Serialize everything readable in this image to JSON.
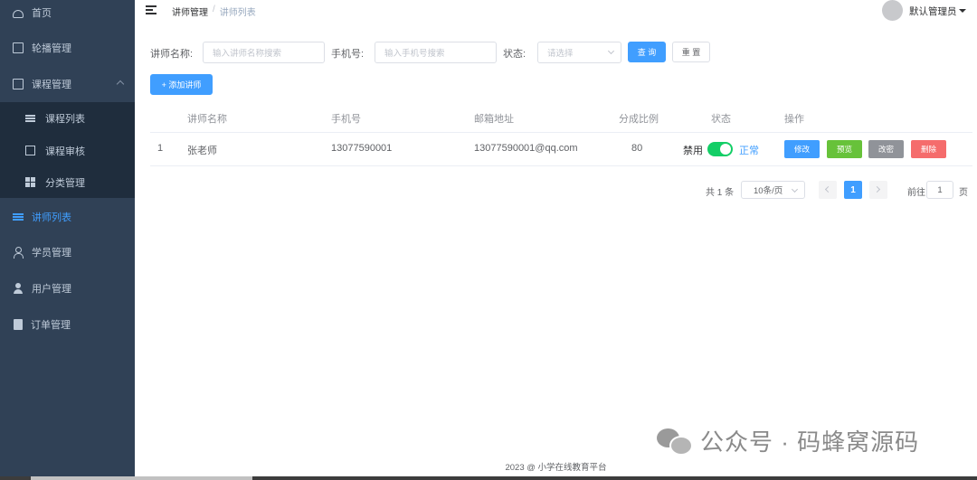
{
  "sidebar": {
    "items": [
      {
        "label": "首页",
        "icon": "dashboard-icon"
      },
      {
        "label": "轮播管理",
        "icon": "screen-icon"
      },
      {
        "label": "课程管理",
        "icon": "document-icon"
      },
      {
        "label": "讲师列表",
        "icon": "list-icon"
      },
      {
        "label": "学员管理",
        "icon": "person-outline-icon"
      },
      {
        "label": "用户管理",
        "icon": "person-icon"
      },
      {
        "label": "订单管理",
        "icon": "clipboard-icon"
      }
    ],
    "submenu": [
      {
        "label": "课程列表",
        "icon": "list-icon"
      },
      {
        "label": "课程审核",
        "icon": "checkbox-icon"
      },
      {
        "label": "分类管理",
        "icon": "grid-icon"
      }
    ],
    "background": "#304156",
    "submenu_background": "#1f2d3d",
    "active_color": "#409eff"
  },
  "header": {
    "breadcrumb": [
      "讲师管理",
      "/",
      "讲师列表"
    ],
    "user": "默认管理员"
  },
  "search": {
    "name_label": "讲师名称:",
    "name_placeholder": "输入讲师名称搜索",
    "phone_label": "手机号:",
    "phone_placeholder": "输入手机号搜索",
    "status_label": "状态:",
    "status_placeholder": "请选择",
    "query_button": "查 询",
    "reset_button": "重 置",
    "add_button": "+ 添加讲师"
  },
  "table": {
    "columns": [
      "讲师名称",
      "手机号",
      "邮箱地址",
      "分成比例",
      "状态",
      "操作"
    ],
    "rows": [
      {
        "index": "1",
        "name": "张老师",
        "phone": "13077590001",
        "email": "13077590001@qq.com",
        "ratio": "80",
        "status_off": "禁用",
        "status_on": "正常",
        "actions": [
          "修改",
          "预览",
          "改密",
          "删除"
        ]
      }
    ],
    "action_colors": [
      "#409eff",
      "#67c23a",
      "#909399",
      "#f56c6c"
    ]
  },
  "pagination": {
    "total": "共 1 条",
    "page_size": "10条/页",
    "current": "1",
    "goto_prefix": "前往",
    "goto_value": "1",
    "goto_suffix": "页"
  },
  "footer": "2023 @ 小学在线教育平台",
  "watermark": "公众号 · 码蜂窝源码"
}
